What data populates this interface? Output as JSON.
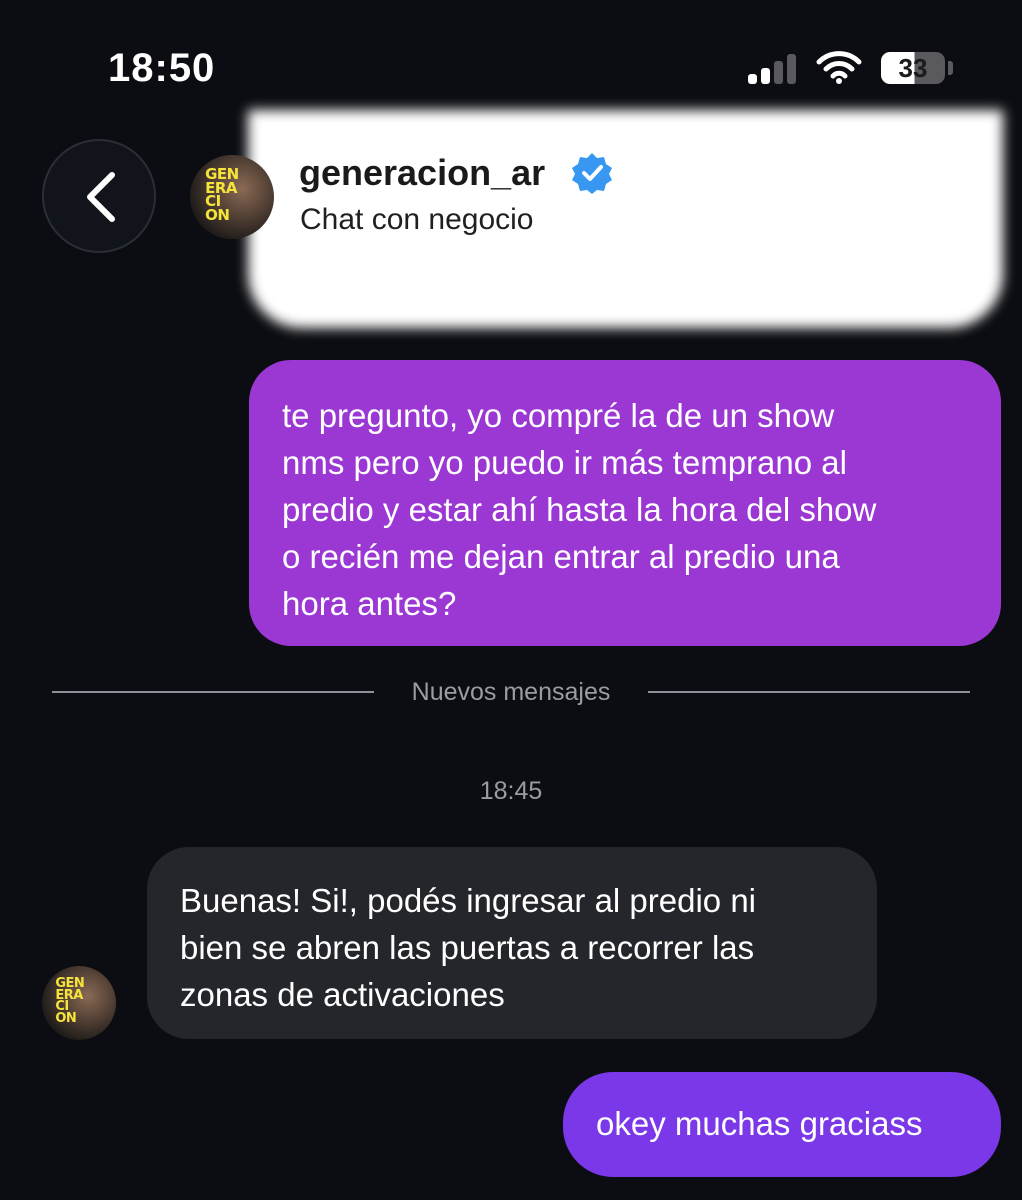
{
  "status_bar": {
    "time": "18:50",
    "battery": "33",
    "signal_bars": 2,
    "signal_bars_total": 4
  },
  "header": {
    "username": "generacion_ar",
    "subtitle": "Chat con negocio",
    "verified": true,
    "avatar_logo_lines": [
      "GEN",
      "ERA",
      "CI",
      "ON"
    ]
  },
  "messages": [
    {
      "direction": "outgoing",
      "text": "te pregunto, yo compré la de un show\nnms pero yo puedo ir más temprano al\npredio y estar ahí hasta la hora del show\no recién me dejan entrar al predio una\nhora antes?"
    },
    {
      "direction": "incoming",
      "text": "Buenas! Si!, podés ingresar al predio ni\nbien se abren las puertas a recorrer las\nzonas de activaciones"
    },
    {
      "direction": "outgoing",
      "text": "okey muchas graciass"
    }
  ],
  "divider": {
    "label": "Nuevos mensajes"
  },
  "timestamp": "18:45",
  "colors": {
    "background": "#0c0d12",
    "outgoing_bubble_1": "#9b38d4",
    "outgoing_bubble_2": "#7a38e8",
    "incoming_bubble": "#24262b",
    "verified_badge": "#3897f0",
    "avatar_logo": "#f5e43a"
  },
  "icons": {
    "back": "chevron-left-icon",
    "verified": "verified-badge-icon",
    "signal": "cellular-signal-icon",
    "wifi": "wifi-icon",
    "battery": "battery-icon"
  }
}
